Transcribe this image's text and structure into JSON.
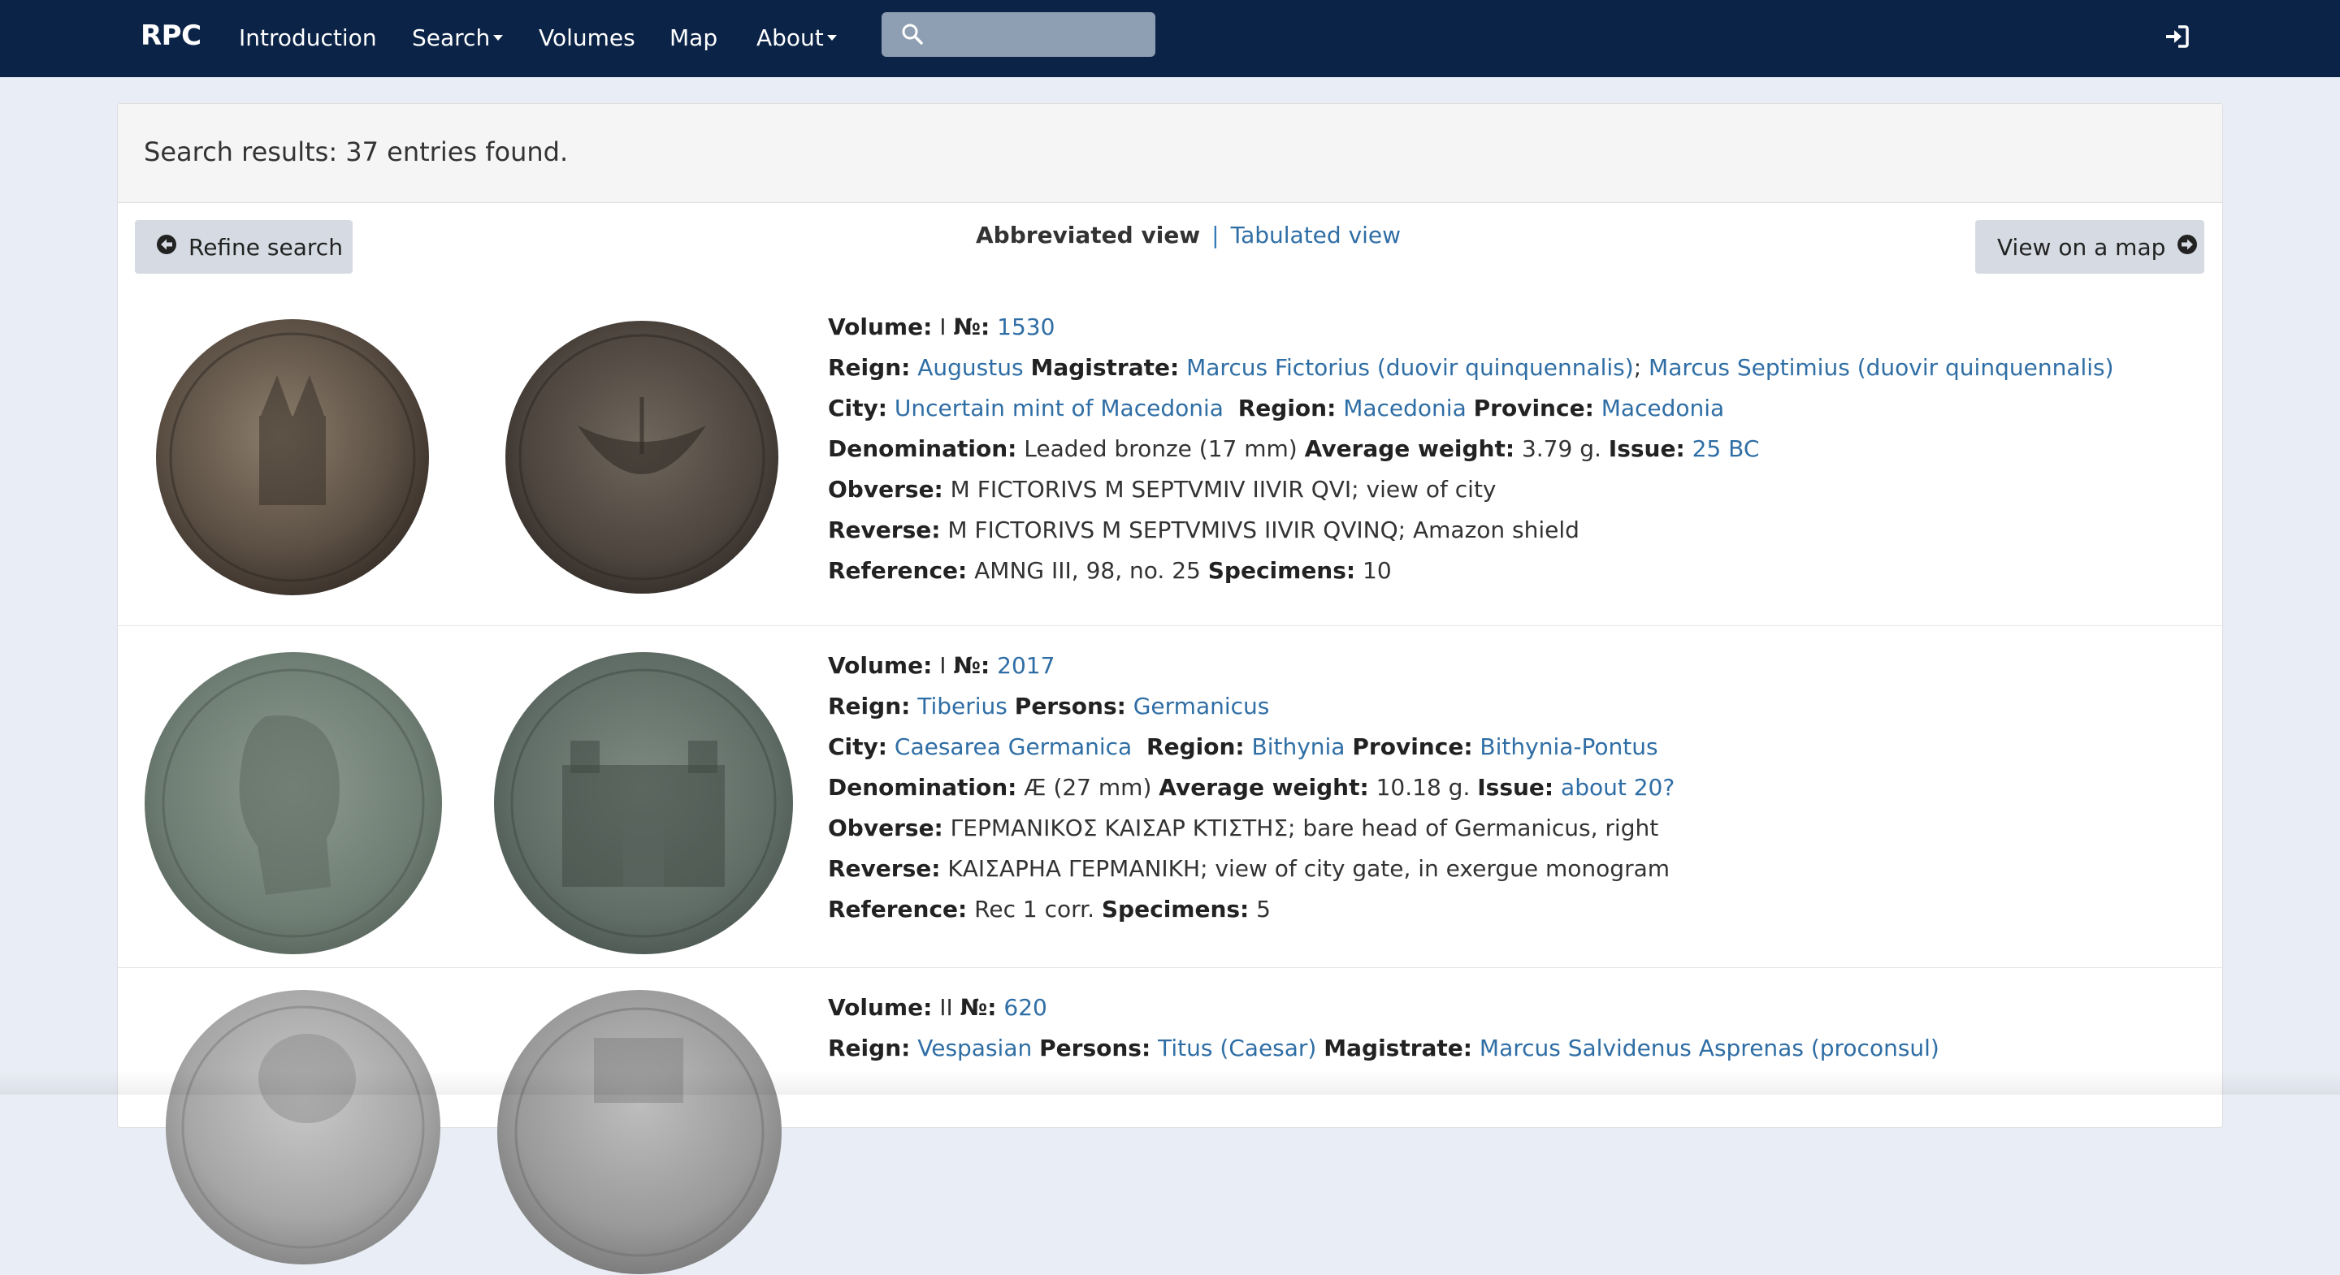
{
  "nav": {
    "brand": "RPC",
    "items": [
      {
        "label": "Introduction"
      },
      {
        "label": "Search"
      },
      {
        "label": "Volumes"
      },
      {
        "label": "Map"
      },
      {
        "label": "About"
      }
    ],
    "search_placeholder": "",
    "icons": {
      "search": "search-icon",
      "login": "sign-in-icon"
    }
  },
  "results": {
    "summary": "Search results: 37 entries found.",
    "refine_label": "Refine search",
    "map_label": "View on a map",
    "views": {
      "active": "Abbreviated view",
      "separator": "|",
      "other": "Tabulated view"
    }
  },
  "entries": [
    {
      "volume_label": "Volume:",
      "volume": "I",
      "no_label": "№:",
      "number": "1530",
      "reign_label": "Reign:",
      "reign": "Augustus",
      "extra_label": "Magistrate:",
      "extra": [
        "Marcus Fictorius (duovir quinquennalis)",
        "Marcus Septimius (duovir quinquennalis)"
      ],
      "city_label": "City:",
      "city": "Uncertain mint of Macedonia",
      "region_label": "Region:",
      "region": "Macedonia",
      "province_label": "Province:",
      "province": "Macedonia",
      "denomination_label": "Denomination:",
      "denomination": "Leaded bronze (17 mm)",
      "weight_label": "Average weight:",
      "weight": "3.79 g.",
      "issue_label": "Issue:",
      "issue": "25 BC",
      "obverse_label": "Obverse:",
      "obverse": "M FICTORIVS M SEPTVMIV IIVIR QVI; view of city",
      "reverse_label": "Reverse:",
      "reverse": "M FICTORIVS M SEPTVMIVS IIVIR QVINQ; Amazon shield",
      "reference_label": "Reference:",
      "reference": "AMNG III, 98, no. 25",
      "specimens_label": "Specimens:",
      "specimens": "10"
    },
    {
      "volume_label": "Volume:",
      "volume": "I",
      "no_label": "№:",
      "number": "2017",
      "reign_label": "Reign:",
      "reign": "Tiberius",
      "extra_label": "Persons:",
      "extra": [
        "Germanicus"
      ],
      "city_label": "City:",
      "city": "Caesarea Germanica",
      "region_label": "Region:",
      "region": "Bithynia",
      "province_label": "Province:",
      "province": "Bithynia-Pontus",
      "denomination_label": "Denomination:",
      "denomination": "Æ (27 mm)",
      "weight_label": "Average weight:",
      "weight": "10.18 g.",
      "issue_label": "Issue:",
      "issue": "about 20?",
      "obverse_label": "Obverse:",
      "obverse": "ΓΕΡΜΑΝΙΚΟΣ ΚΑΙΣΑΡ ΚΤΙΣΤΗΣ; bare head of Germanicus, right",
      "reverse_label": "Reverse:",
      "reverse": "ΚΑΙΣΑΡΗΑ ΓΕΡΜΑΝΙΚΗ; view of city gate, in exergue monogram",
      "reference_label": "Reference:",
      "reference": "Rec 1 corr.",
      "specimens_label": "Specimens:",
      "specimens": "5"
    },
    {
      "volume_label": "Volume:",
      "volume": "II",
      "no_label": "№:",
      "number": "620",
      "reign_label": "Reign:",
      "reign": "Vespasian",
      "persons_label": "Persons:",
      "persons": "Titus (Caesar)",
      "magistrate_label": "Magistrate:",
      "magistrate": "Marcus Salvidenus Asprenas (proconsul)"
    }
  ],
  "colors": {
    "navbar": "#0b2347",
    "link": "#2f6ea5",
    "button": "#d6dbe3",
    "page_bg": "#e9eef6"
  }
}
